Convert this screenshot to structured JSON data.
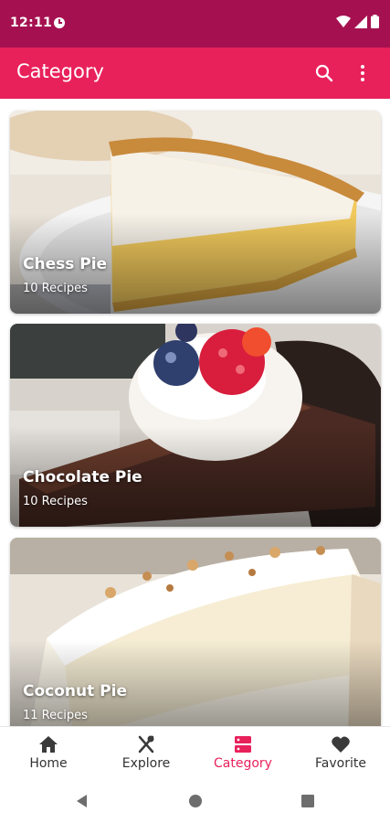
{
  "status_bar": {
    "time": "12:11"
  },
  "app_bar": {
    "title": "Category",
    "search_icon": "search-icon",
    "more_icon": "more-vert-icon"
  },
  "categories": [
    {
      "title": "Chess Pie",
      "count": "10 Recipes"
    },
    {
      "title": "Chocolate Pie",
      "count": "10 Recipes"
    },
    {
      "title": "Coconut Pie",
      "count": "11 Recipes"
    }
  ],
  "bottom_nav": {
    "items": [
      {
        "label": "Home",
        "icon": "home-icon"
      },
      {
        "label": "Explore",
        "icon": "utensils-icon"
      },
      {
        "label": "Category",
        "icon": "category-icon",
        "active": true
      },
      {
        "label": "Favorite",
        "icon": "heart-icon"
      }
    ]
  },
  "colors": {
    "status_bar": "#a51150",
    "app_bar": "#e8215b",
    "active": "#e8215b"
  }
}
